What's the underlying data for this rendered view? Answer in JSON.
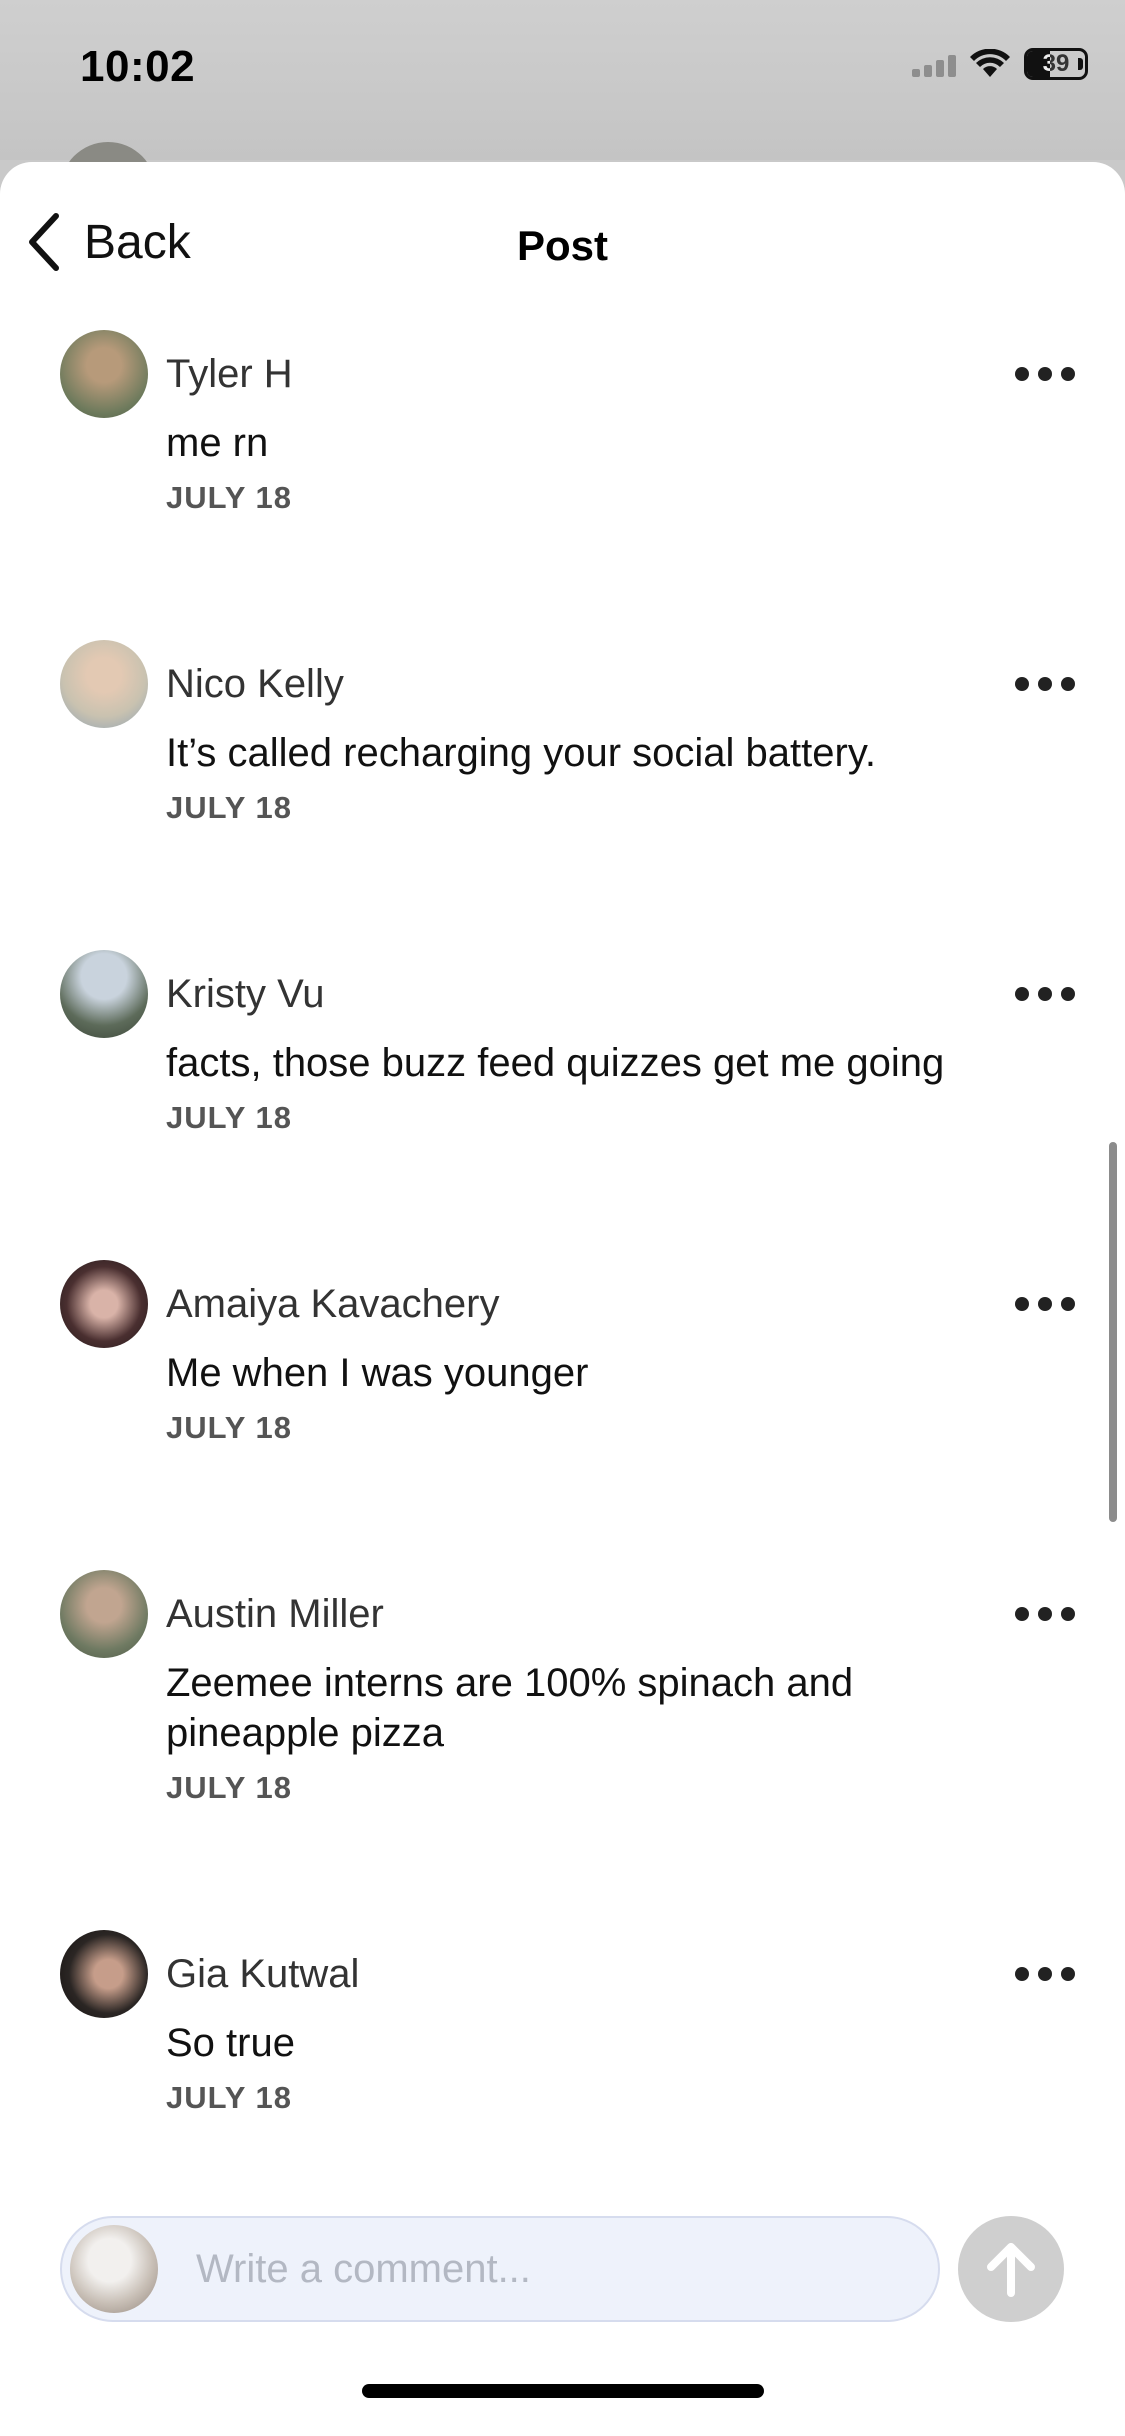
{
  "status_bar": {
    "time": "10:02",
    "battery": "39",
    "battery_fraction": 0.39
  },
  "nav": {
    "back_label": "Back",
    "title": "Post"
  },
  "comments": [
    {
      "name": "Tyler H",
      "text": "me rn",
      "date": "JULY 18",
      "avatar_color": "#6d7a5c"
    },
    {
      "name": "Nico Kelly",
      "text": "It’s called recharging your social battery.",
      "date": "JULY 18",
      "avatar_color": "#c9c2b0"
    },
    {
      "name": "Kristy Vu",
      "text": "facts, those buzz feed quizzes get me going",
      "date": "JULY 18",
      "avatar_color": "#5d6b5a"
    },
    {
      "name": "Amaiya Kavachery",
      "text": "Me when I was younger",
      "date": "JULY 18",
      "avatar_color": "#4a2f30"
    },
    {
      "name": "Austin Miller",
      "text": "Zeemee interns are 100% spinach and pineapple pizza",
      "date": "JULY 18",
      "avatar_color": "#6f7a62"
    },
    {
      "name": "Gia Kutwal",
      "text": "So true",
      "date": "JULY 18",
      "avatar_color": "#2b2624"
    }
  ],
  "composer": {
    "placeholder": "Write a comment..."
  },
  "icons": {
    "back": "chevron-left-icon",
    "more": "ellipsis-icon",
    "send": "arrow-up-icon",
    "wifi": "wifi-icon",
    "signal": "cellular-signal-icon",
    "battery": "battery-icon"
  }
}
